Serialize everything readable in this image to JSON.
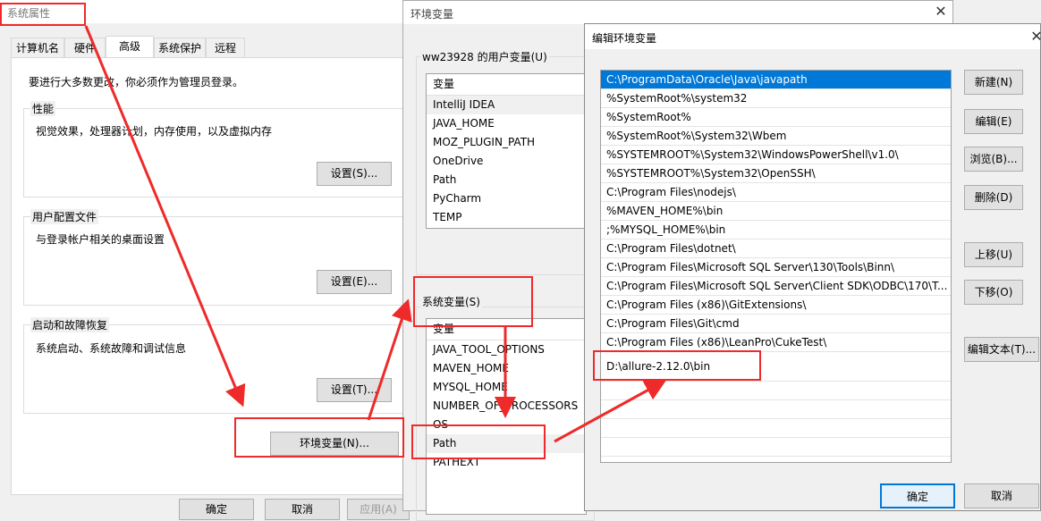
{
  "sysprops": {
    "title": "系统属性",
    "tabs": [
      "计算机名",
      "硬件",
      "高级",
      "系统保护",
      "远程"
    ],
    "admin_notice": "要进行大多数更改，你必须作为管理员登录。",
    "performance": {
      "label": "性能",
      "desc": "视觉效果，处理器计划，内存使用，以及虚拟内存",
      "button": "设置(S)..."
    },
    "profiles": {
      "label": "用户配置文件",
      "desc": "与登录帐户相关的桌面设置",
      "button": "设置(E)..."
    },
    "startup": {
      "label": "启动和故障恢复",
      "desc": "系统启动、系统故障和调试信息",
      "button": "设置(T)..."
    },
    "env_button": "环境变量(N)...",
    "ok": "确定",
    "cancel": "取消",
    "apply": "应用(A)"
  },
  "envvars": {
    "title": "环境变量",
    "user_group": "ww23928 的用户变量(U)",
    "user_header": "变量",
    "user_vars": [
      "IntelliJ IDEA",
      "JAVA_HOME",
      "MOZ_PLUGIN_PATH",
      "OneDrive",
      "Path",
      "PyCharm",
      "TEMP"
    ],
    "sys_group": "系统变量(S)",
    "sys_header": "变量",
    "sys_vars": [
      "JAVA_TOOL_OPTIONS",
      "MAVEN_HOME",
      "MYSQL_HOME",
      "NUMBER_OF_PROCESSORS",
      "OS",
      "Path",
      "PATHEXT"
    ]
  },
  "editenv": {
    "title": "编辑环境变量",
    "paths": [
      "C:\\ProgramData\\Oracle\\Java\\javapath",
      "%SystemRoot%\\system32",
      "%SystemRoot%",
      "%SystemRoot%\\System32\\Wbem",
      "%SYSTEMROOT%\\System32\\WindowsPowerShell\\v1.0\\",
      "%SYSTEMROOT%\\System32\\OpenSSH\\",
      "C:\\Program Files\\nodejs\\",
      "%MAVEN_HOME%\\bin",
      ";%MYSQL_HOME%\\bin",
      "C:\\Program Files\\dotnet\\",
      "C:\\Program Files\\Microsoft SQL Server\\130\\Tools\\Binn\\",
      "C:\\Program Files\\Microsoft SQL Server\\Client SDK\\ODBC\\170\\T...",
      "C:\\Program Files (x86)\\GitExtensions\\",
      "C:\\Program Files\\Git\\cmd",
      "C:\\Program Files (x86)\\LeanPro\\CukeTest\\",
      "D:\\allure-2.12.0\\bin"
    ],
    "buttons": {
      "new": "新建(N)",
      "edit": "编辑(E)",
      "browse": "浏览(B)...",
      "delete": "删除(D)",
      "move_up": "上移(U)",
      "move_down": "下移(O)",
      "edit_text": "编辑文本(T)..."
    },
    "ok": "确定",
    "cancel": "取消"
  },
  "colors": {
    "highlight": "#0078d7",
    "annotation": "#ee2a2a"
  }
}
